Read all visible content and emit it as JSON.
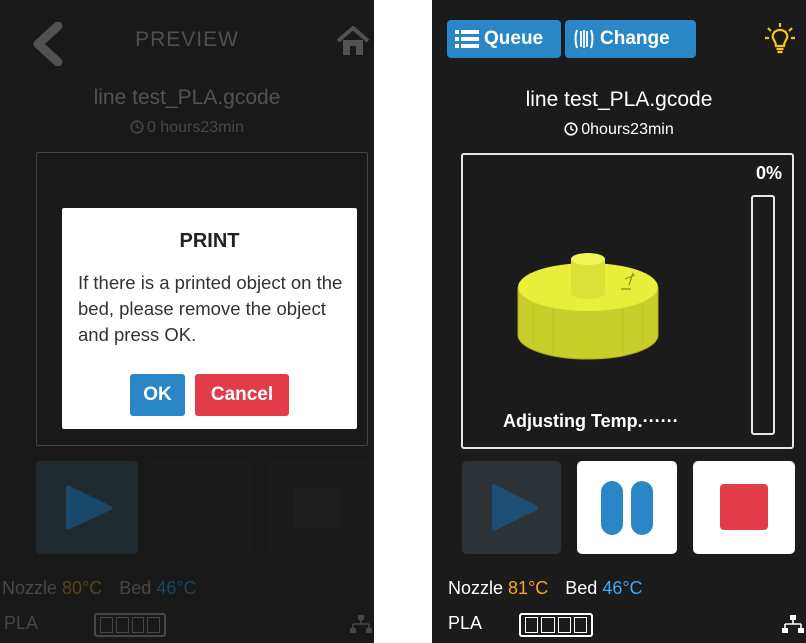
{
  "left_screen": {
    "header": {
      "title": "PREVIEW",
      "back_icon": "chevron-left-icon",
      "home_icon": "home-icon"
    },
    "file_name": "line test_PLA.gcode",
    "print_time": "0 hours23min",
    "dialog": {
      "title": "PRINT",
      "message": "If there is a printed object on the bed, please remove the object and press OK.",
      "ok_label": "OK",
      "cancel_label": "Cancel"
    },
    "status": {
      "nozzle_label": "Nozzle",
      "nozzle_value": "80°C",
      "bed_label": "Bed",
      "bed_value": "46°C"
    },
    "filament": {
      "label": "PLA"
    }
  },
  "right_screen": {
    "toolbar": {
      "queue_label": "Queue",
      "change_label": "Change",
      "light_icon": "lightbulb-icon"
    },
    "file_name": "line test_PLA.gcode",
    "print_time": "0hours23min",
    "progress": {
      "percent_label": "0%",
      "value": 0
    },
    "status_message": "Adjusting Temp.······",
    "status": {
      "nozzle_label": "Nozzle",
      "nozzle_value": "81°C",
      "bed_label": "Bed",
      "bed_value": "46°C"
    },
    "filament": {
      "label": "PLA"
    }
  },
  "colors": {
    "accent_blue": "#2a86c6",
    "stop_red": "#e23b4a",
    "nozzle_orange": "#f5a623",
    "bed_blue": "#3fa9f5",
    "model_yellow": "#e8ee3a"
  }
}
